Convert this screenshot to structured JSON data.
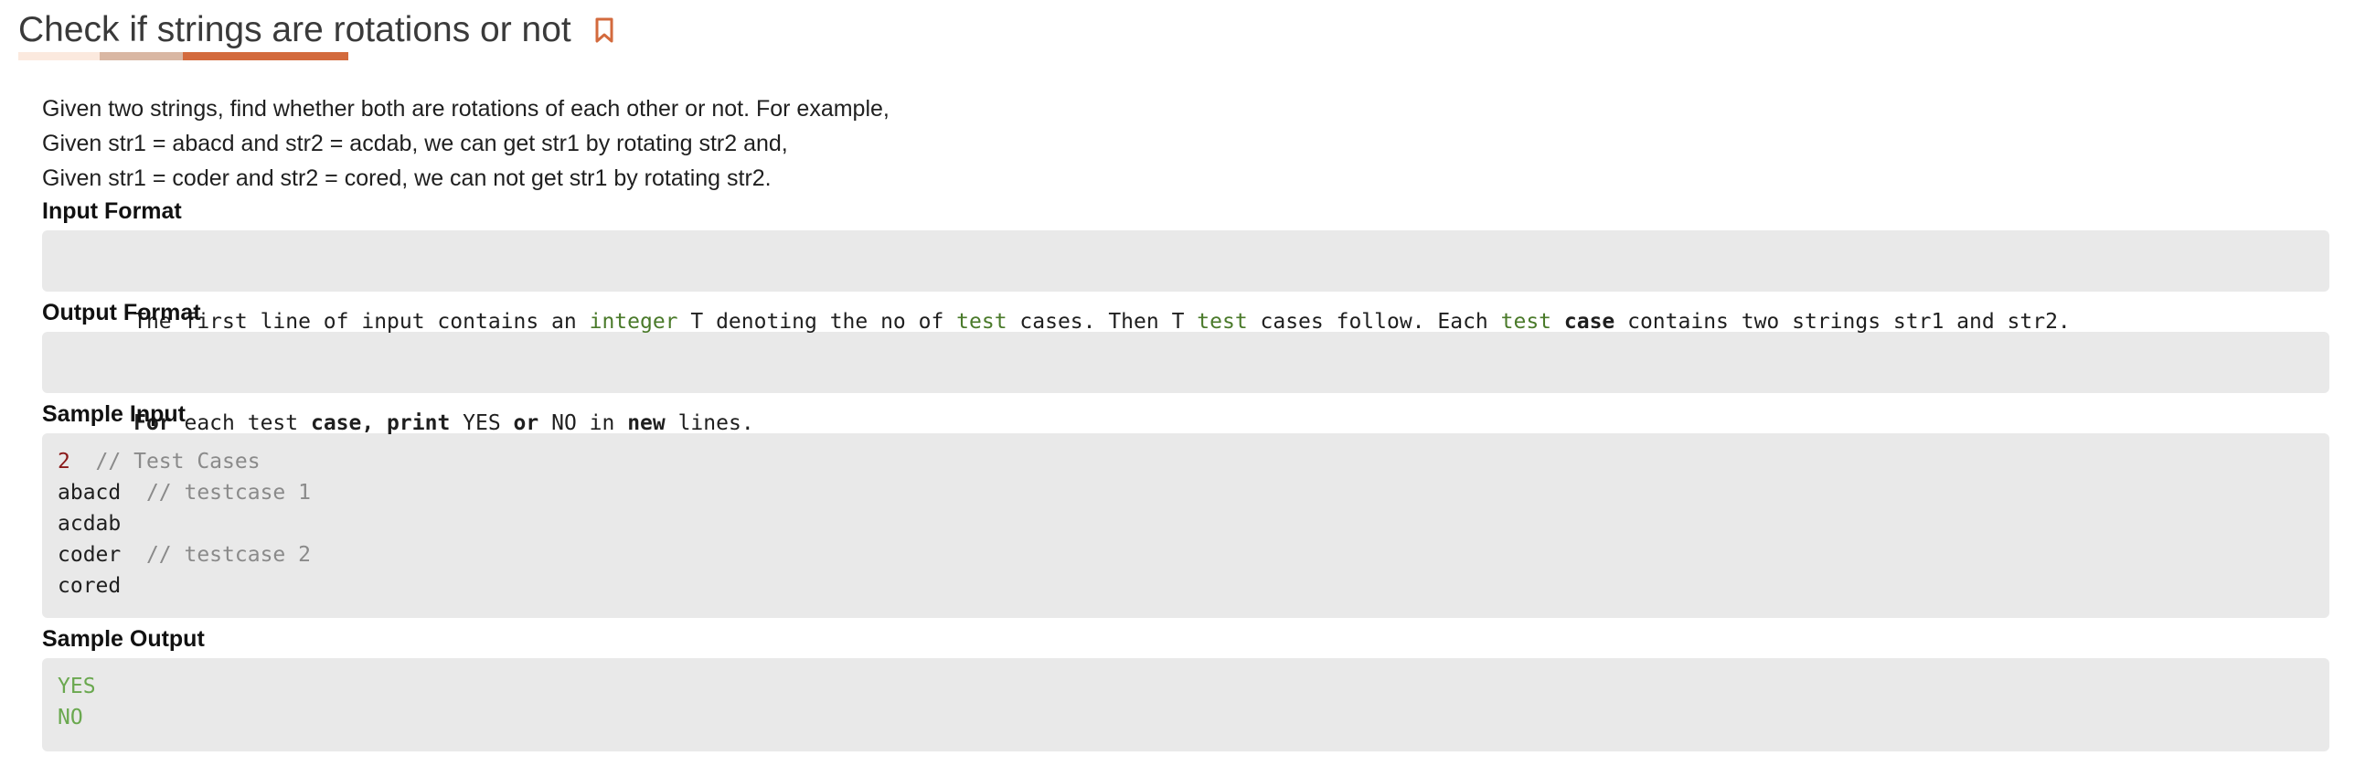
{
  "header": {
    "title": "Check if strings are rotations or not",
    "bookmark_icon": "bookmark-icon",
    "accent_color": "#d36a3d"
  },
  "description": {
    "lines": [
      "Given two strings, find whether both are rotations of each other or not. For example,",
      "Given str1 = abacd and str2 = acdab, we can get str1 by rotating str2 and,",
      "Given str1 = coder and str2 = cored, we can not get str1 by rotating str2."
    ]
  },
  "input_format": {
    "heading": "Input Format",
    "segments": [
      {
        "text": "The first line of input contains an ",
        "style": "plain"
      },
      {
        "text": "integer",
        "style": "green"
      },
      {
        "text": " T denoting the no of ",
        "style": "plain"
      },
      {
        "text": "test",
        "style": "green"
      },
      {
        "text": " cases. Then T ",
        "style": "plain"
      },
      {
        "text": "test",
        "style": "green"
      },
      {
        "text": " cases follow. Each ",
        "style": "plain"
      },
      {
        "text": "test",
        "style": "green"
      },
      {
        "text": " ",
        "style": "plain"
      },
      {
        "text": "case",
        "style": "bold"
      },
      {
        "text": " contains two strings str1 and str2.",
        "style": "plain"
      }
    ]
  },
  "output_format": {
    "heading": "Output Format",
    "segments": [
      {
        "text": "For",
        "style": "bold"
      },
      {
        "text": " each test ",
        "style": "plain"
      },
      {
        "text": "case, print",
        "style": "bold"
      },
      {
        "text": " YES ",
        "style": "plain"
      },
      {
        "text": "or",
        "style": "bold"
      },
      {
        "text": " NO in ",
        "style": "plain"
      },
      {
        "text": "new",
        "style": "bold"
      },
      {
        "text": " lines.",
        "style": "plain"
      }
    ]
  },
  "sample_input": {
    "heading": "Sample Input",
    "lines": [
      [
        {
          "text": "2",
          "style": "num"
        },
        {
          "text": "  // Test Cases",
          "style": "comment"
        }
      ],
      [
        {
          "text": "abacd",
          "style": "plain"
        },
        {
          "text": "  // testcase 1",
          "style": "comment"
        }
      ],
      [
        {
          "text": "acdab",
          "style": "plain"
        }
      ],
      [
        {
          "text": "coder",
          "style": "plain"
        },
        {
          "text": "  // testcase 2",
          "style": "comment"
        }
      ],
      [
        {
          "text": "cored",
          "style": "plain"
        }
      ]
    ]
  },
  "sample_output": {
    "heading": "Sample Output",
    "lines": [
      "YES",
      "NO"
    ]
  }
}
